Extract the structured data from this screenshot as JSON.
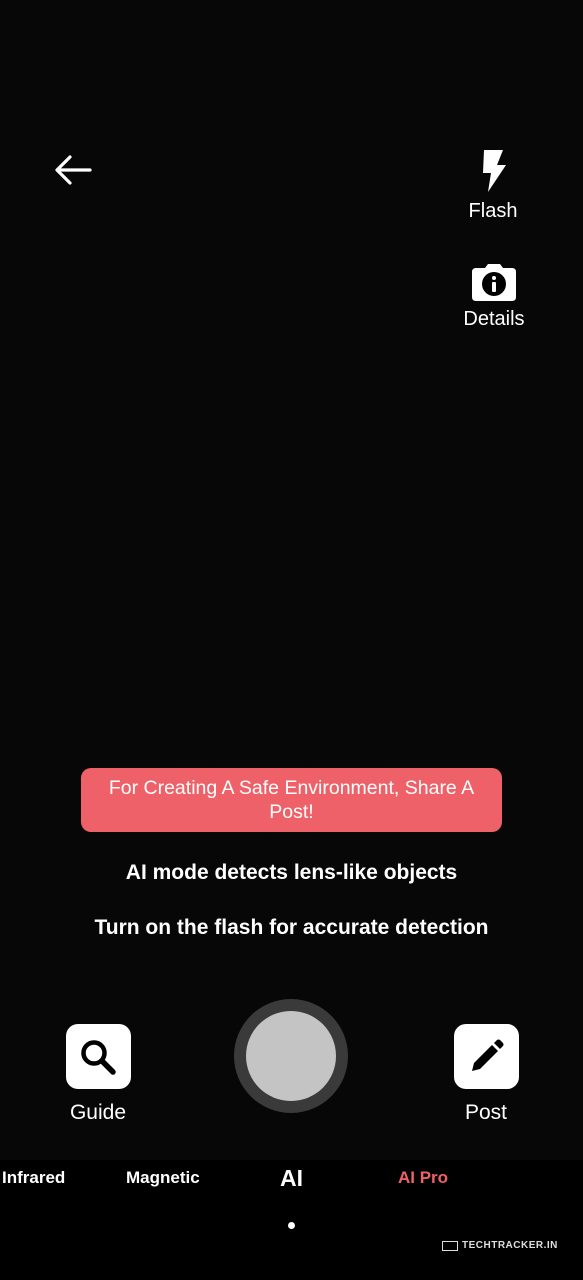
{
  "header": {
    "back_icon": "arrow-left-icon",
    "flash": {
      "icon": "lightning-bolt-icon",
      "label": "Flash"
    },
    "details": {
      "icon": "camera-info-icon",
      "label": "Details"
    }
  },
  "banner": {
    "text": "For Creating A Safe Environment, Share A Post!",
    "color": "#ef6168"
  },
  "hints": {
    "line1": "AI mode detects lens-like objects",
    "line2": "Turn on the flash for accurate detection"
  },
  "actions": {
    "guide": {
      "icon": "search-icon",
      "label": "Guide"
    },
    "post": {
      "icon": "pencil-icon",
      "label": "Post"
    },
    "shutter_icon": "shutter-button"
  },
  "modes": {
    "items": [
      {
        "label": "Infrared",
        "selected": false
      },
      {
        "label": "Magnetic",
        "selected": false
      },
      {
        "label": "AI",
        "selected": true
      },
      {
        "label": "AI Pro",
        "selected": false,
        "color": "#ef6168"
      }
    ]
  },
  "watermark": "TECHTRACKER.IN"
}
